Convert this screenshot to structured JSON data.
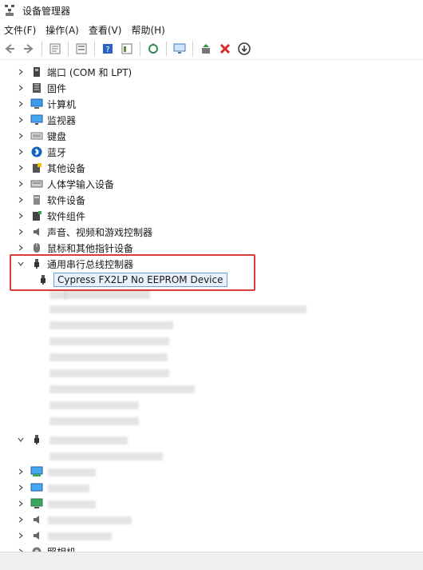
{
  "window": {
    "title": "设备管理器",
    "icon": "device-manager-icon"
  },
  "menu": [
    {
      "id": "file",
      "label": "文件(F)"
    },
    {
      "id": "action",
      "label": "操作(A)"
    },
    {
      "id": "view",
      "label": "查看(V)"
    },
    {
      "id": "help",
      "label": "帮助(H)"
    }
  ],
  "toolbar": {
    "icons": [
      "back-arrow-icon",
      "forward-arrow-icon",
      "properties-icon",
      "list-icon",
      "help-icon",
      "show-hidden-icon",
      "scan-hardware-icon",
      "monitor-icon",
      "update-driver-icon",
      "uninstall-icon",
      "disable-icon"
    ]
  },
  "tree": {
    "categories": [
      {
        "label": "端口 (COM 和 LPT)",
        "icon": "port-icon"
      },
      {
        "label": "固件",
        "icon": "firmware-icon"
      },
      {
        "label": "计算机",
        "icon": "computer-icon"
      },
      {
        "label": "监视器",
        "icon": "monitor-icon"
      },
      {
        "label": "键盘",
        "icon": "keyboard-icon"
      },
      {
        "label": "蓝牙",
        "icon": "bluetooth-icon"
      },
      {
        "label": "其他设备",
        "icon": "other-device-icon"
      },
      {
        "label": "人体学输入设备",
        "icon": "hid-icon"
      },
      {
        "label": "软件设备",
        "icon": "software-device-icon"
      },
      {
        "label": "软件组件",
        "icon": "software-component-icon"
      },
      {
        "label": "声音、视频和游戏控制器",
        "icon": "speaker-icon"
      },
      {
        "label": "鼠标和其他指针设备",
        "icon": "mouse-icon"
      }
    ],
    "expanded": {
      "label": "通用串行总线控制器",
      "icon": "usb-icon",
      "selected_child": "Cypress FX2LP No EEPROM Device"
    },
    "bottom_label": "照相机"
  }
}
